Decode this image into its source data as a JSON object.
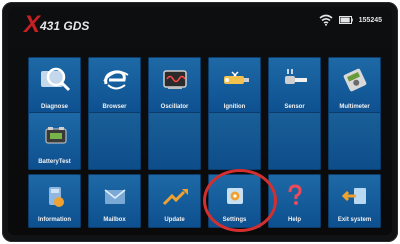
{
  "app": {
    "brand_x": "X",
    "brand_text": "431 GDS"
  },
  "status": {
    "time": "155245"
  },
  "grid": {
    "row1": [
      {
        "label": "Diagnose"
      },
      {
        "label": "Browser"
      },
      {
        "label": "Oscillator"
      },
      {
        "label": "Ignition"
      },
      {
        "label": "Sensor"
      },
      {
        "label": "Multimeter"
      }
    ],
    "row2": [
      {
        "label": "BatteryTest"
      },
      {
        "label": ""
      },
      {
        "label": ""
      },
      {
        "label": ""
      },
      {
        "label": ""
      },
      {
        "label": ""
      }
    ],
    "row3": [
      {
        "label": "Information"
      },
      {
        "label": "Mailbox"
      },
      {
        "label": "Update"
      },
      {
        "label": "Settings"
      },
      {
        "label": "Help"
      },
      {
        "label": "Exit system"
      }
    ]
  },
  "colors": {
    "tile": "#1e6aa6",
    "highlight": "#d32f2f",
    "brand": "#c62024"
  },
  "icons": {
    "wifi": "wifi-icon",
    "battery": "battery-icon"
  }
}
